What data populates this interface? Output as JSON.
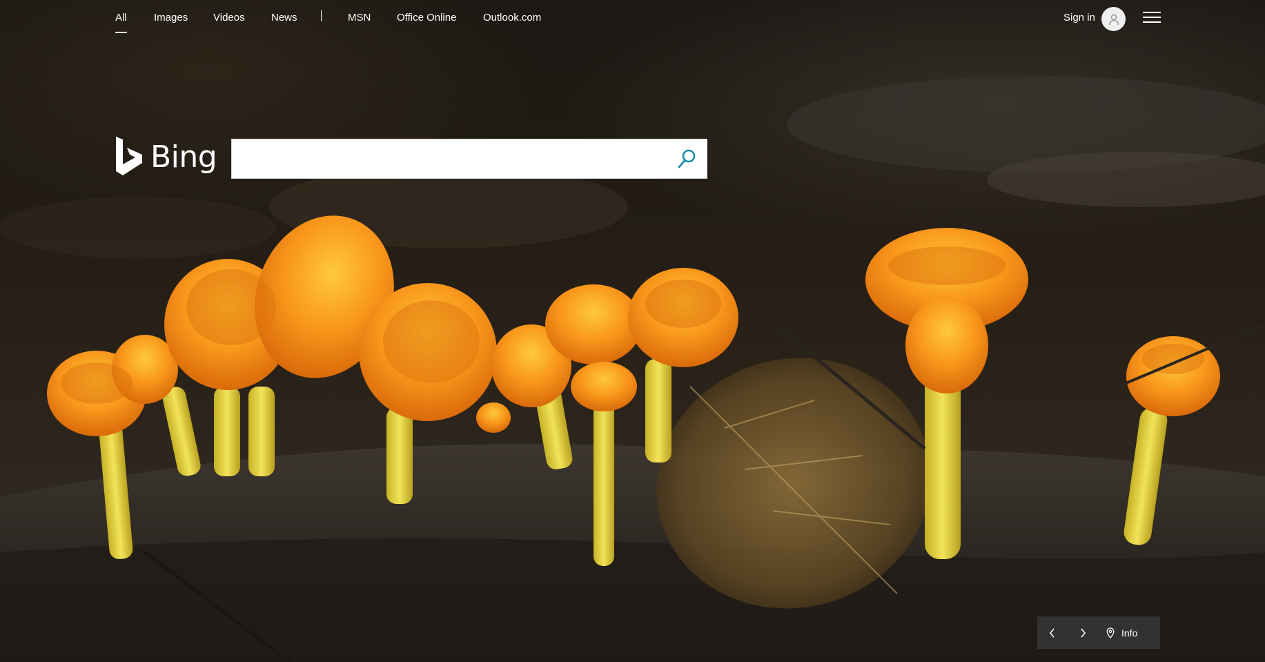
{
  "nav": {
    "items": [
      {
        "label": "All",
        "active": true
      },
      {
        "label": "Images"
      },
      {
        "label": "Videos"
      },
      {
        "label": "News"
      }
    ],
    "separator": "|",
    "links": [
      {
        "label": "MSN"
      },
      {
        "label": "Office Online"
      },
      {
        "label": "Outlook.com"
      }
    ],
    "sign_in": "Sign in"
  },
  "logo": {
    "text": "Bing"
  },
  "search": {
    "value": "",
    "placeholder": ""
  },
  "image_controls": {
    "info_label": "Info"
  },
  "colors": {
    "search_icon": "#1e8ba8",
    "nav_text": "#ffffff",
    "control_bg": "#3c3c3c",
    "mushroom": "#f49018"
  },
  "icons": [
    "user-icon",
    "hamburger-icon",
    "bing-logo-icon",
    "search-icon",
    "chevron-left-icon",
    "chevron-right-icon",
    "location-pin-icon"
  ]
}
